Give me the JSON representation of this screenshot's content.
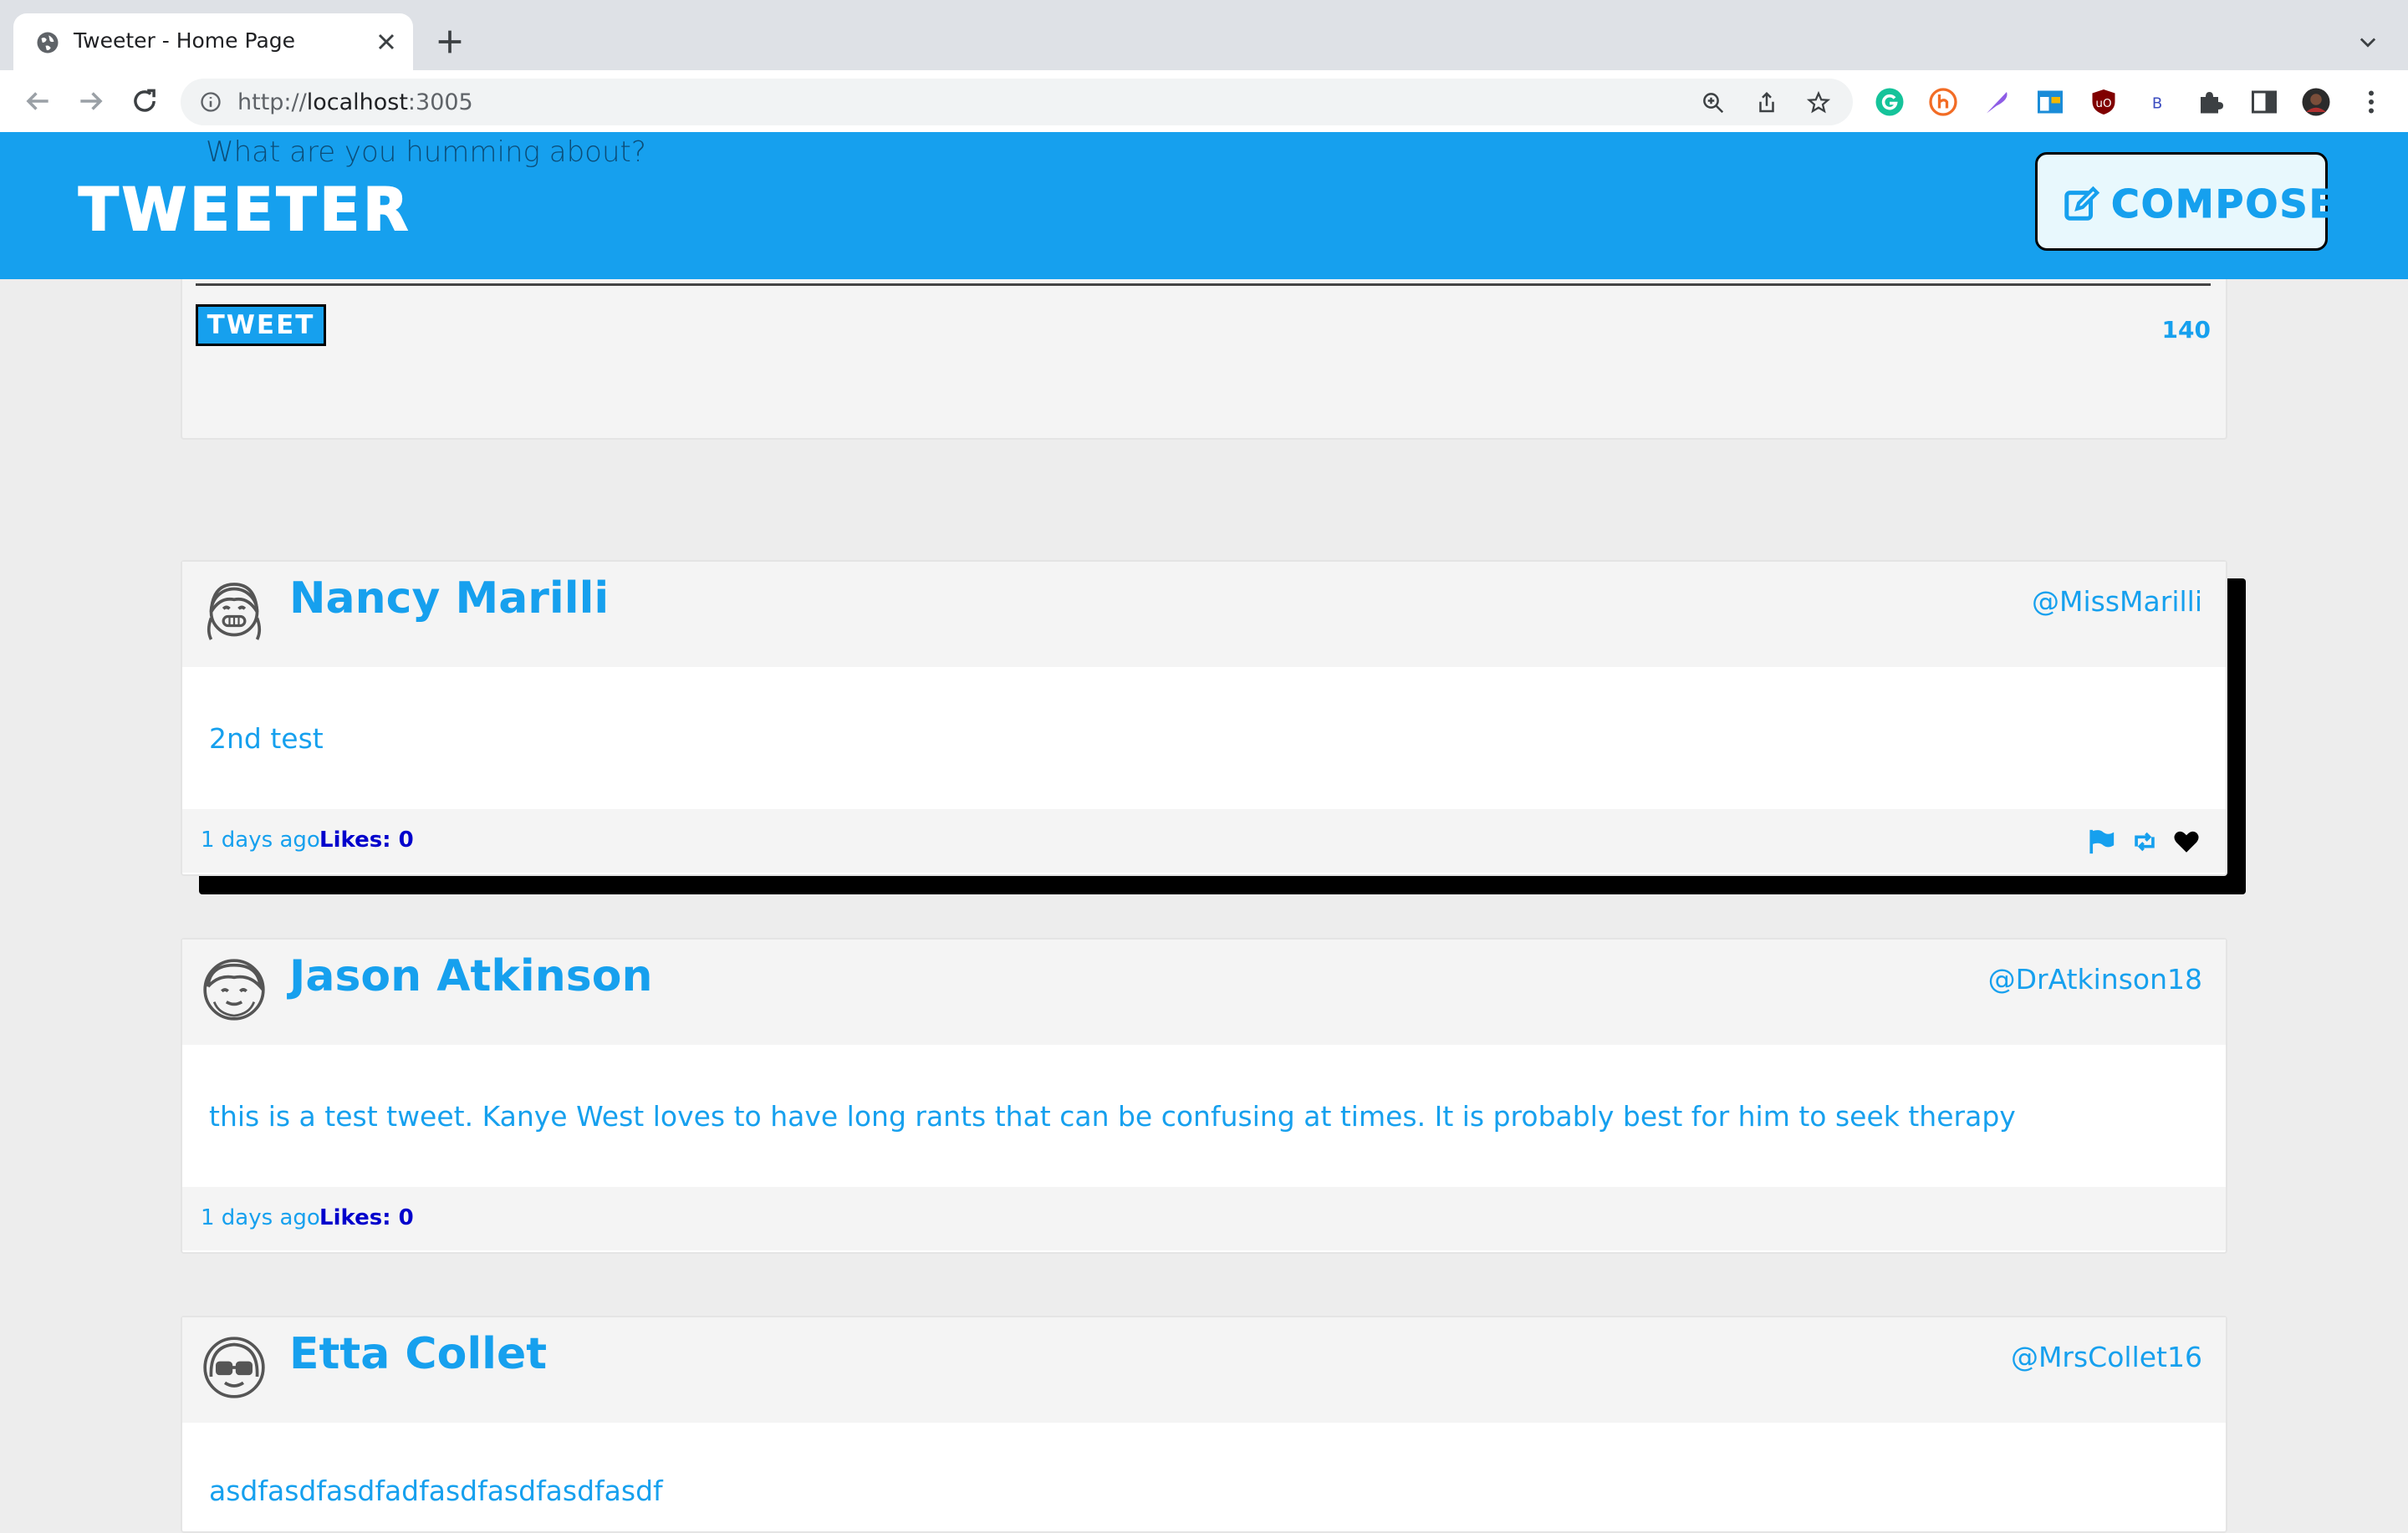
{
  "browser": {
    "tab_title": "Tweeter - Home Page",
    "url_prefix": "http://",
    "url_host": "localhost",
    "url_port": ":3005"
  },
  "header": {
    "hint": "What are you humming about?",
    "logo": "TWEETER",
    "compose_label": "COMPOSE"
  },
  "composer": {
    "submit_label": "TWEET",
    "counter": "140"
  },
  "tweets": [
    {
      "name": "Nancy Marilli",
      "handle": "@MissMarilli",
      "text": "2nd test",
      "time": "1 days ago",
      "likes": "Likes: 0"
    },
    {
      "name": "Jason Atkinson",
      "handle": "@DrAtkinson18",
      "text": "this is a test tweet. Kanye West loves to have long rants that can be confusing at times. It is probably best for him to seek therapy",
      "time": "1 days ago",
      "likes": "Likes: 0"
    },
    {
      "name": "Etta Collet",
      "handle": "@MrsCollet16",
      "text": "asdfasdfasdfadfasdfasdfasdfasdf"
    }
  ],
  "colors": {
    "accent": "#16a0ee",
    "likes": "#0000cc",
    "page_bg": "#ededed"
  }
}
